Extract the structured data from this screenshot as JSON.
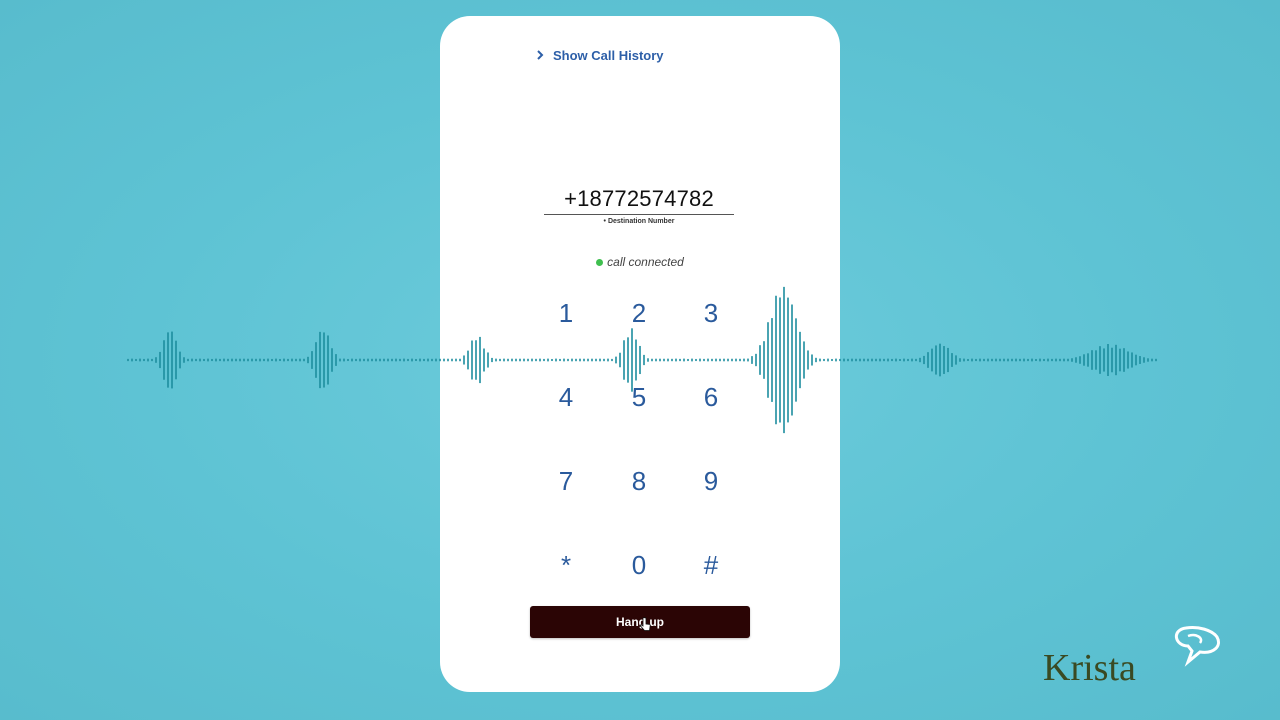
{
  "colors": {
    "background": "#5ec3d4",
    "accent": "#2a5a9c",
    "status_connected": "#3fbf4f",
    "hangup_button": "#2b0505",
    "waveform": "#1d8e9e",
    "logo": "#3a4a22"
  },
  "phone": {
    "history_link": "Show Call History",
    "destination_number": "+18772574782",
    "destination_label": "• Destination Number",
    "status_text": "call connected",
    "keypad": [
      "1",
      "2",
      "3",
      "4",
      "5",
      "6",
      "7",
      "8",
      "9",
      "*",
      "0",
      "#"
    ],
    "hangup_label": "Hang up"
  },
  "overlay": {
    "logo_text": "Krista",
    "logo_icon": "speech-bubble-icon"
  }
}
